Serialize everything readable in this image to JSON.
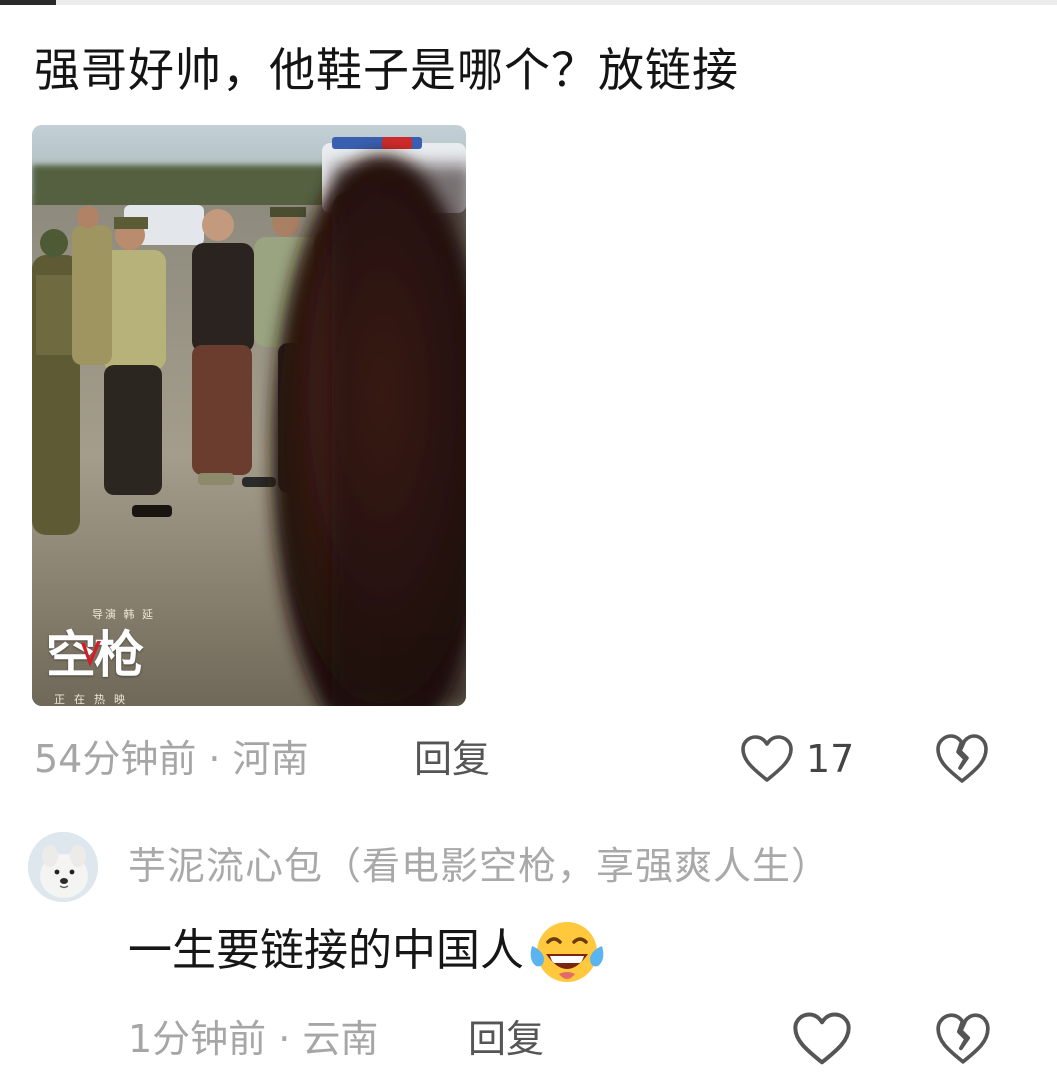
{
  "comment": {
    "text": "强哥好帅，他鞋子是哪个？放链接",
    "poster": {
      "credit": "导演 韩 延",
      "title": "空枪",
      "tagline": "正在热映"
    },
    "time_location": "54分钟前 · 河南",
    "reply_label": "回复",
    "like_count": "17",
    "icons": {
      "like": "heart-outline-icon",
      "dislike": "broken-heart-icon"
    }
  },
  "reply": {
    "author": "芋泥流心包（看电影空枪，享强爽人生）",
    "text": "一生要链接的中国人",
    "emoji": "tears-of-joy-emoji",
    "time_location": "1分钟前 · 云南",
    "reply_label": "回复"
  },
  "colors": {
    "meta_gray": "#a6a6a6",
    "text_dark": "#161616",
    "reply_action": "#555555"
  }
}
